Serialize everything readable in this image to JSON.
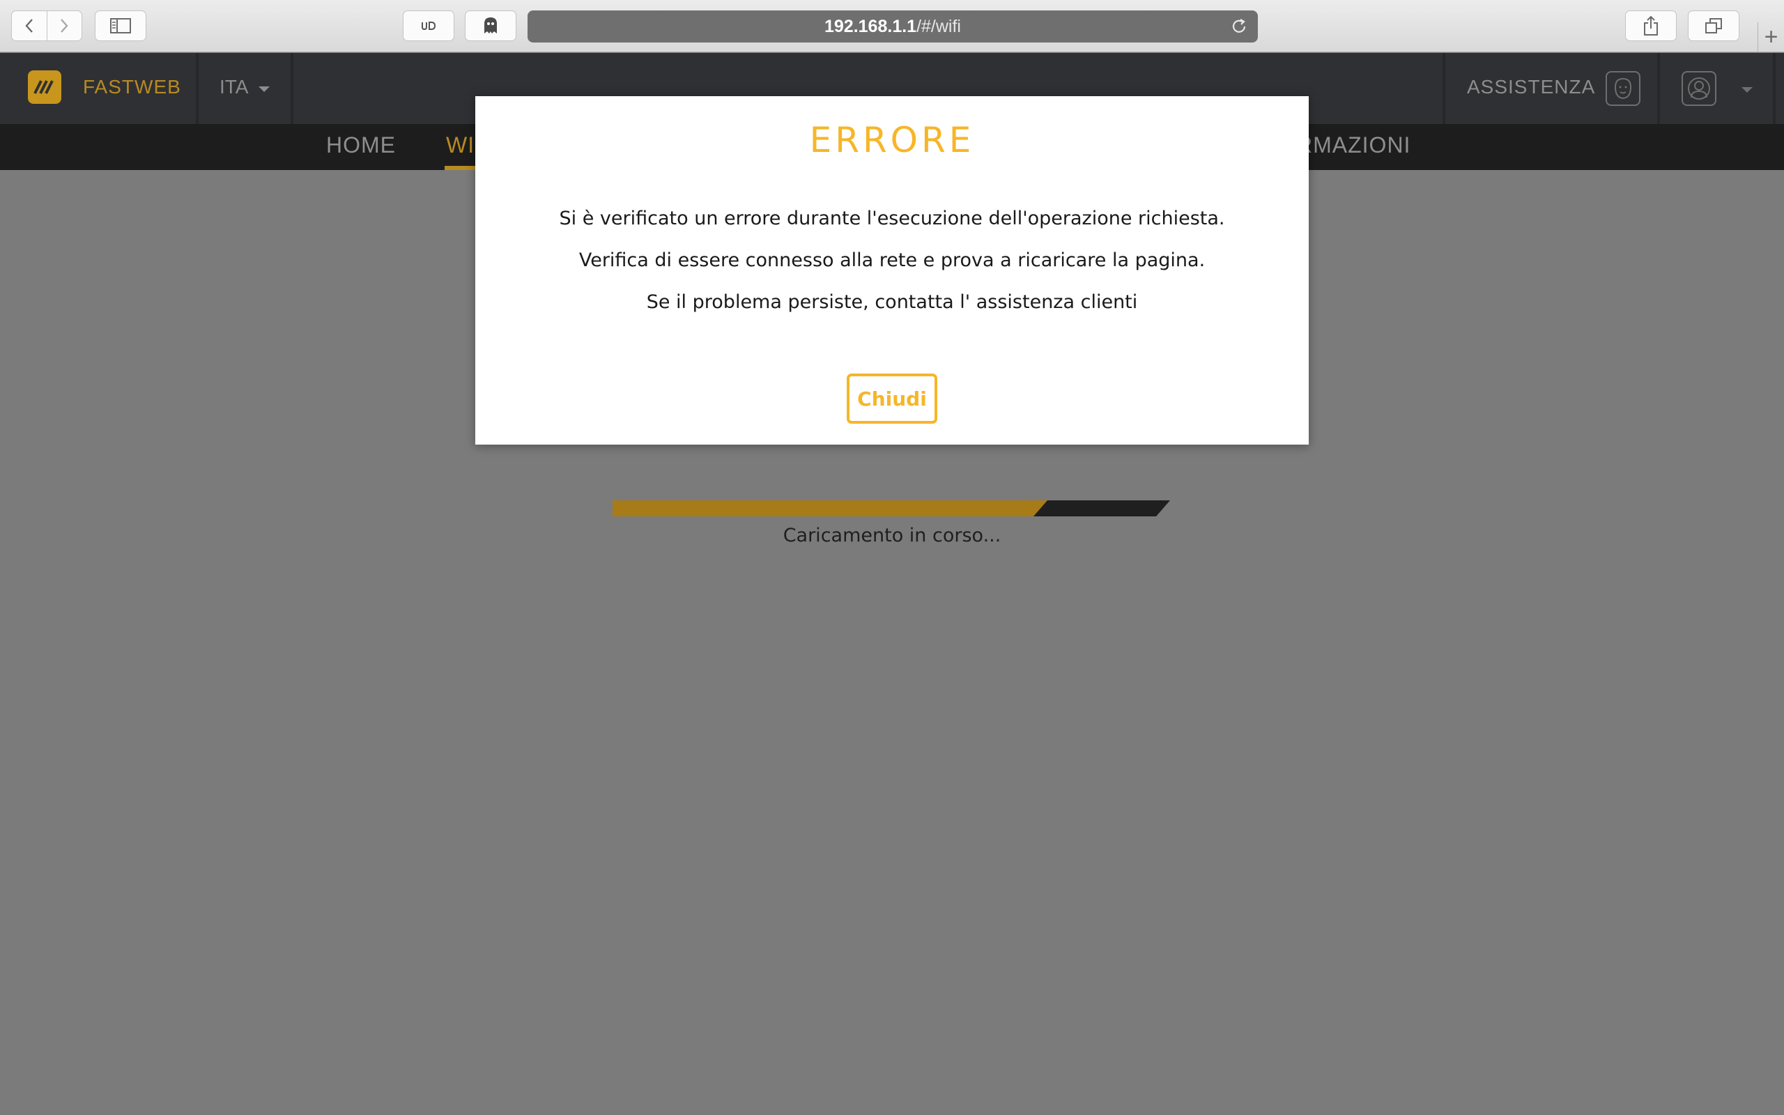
{
  "browser": {
    "url_host": "192.168.1.1",
    "url_path": "/#/wifi",
    "new_tab": "+"
  },
  "header": {
    "brand": "FASTWEB",
    "language": "ITA",
    "assist_label": "ASSISTENZA"
  },
  "menu": {
    "items": [
      {
        "label": "HOME"
      },
      {
        "label": "WI"
      },
      {
        "label": "RMAZIONI"
      }
    ]
  },
  "loading": {
    "text": "Caricamento in corso...",
    "progress_fraction": 0.78
  },
  "modal": {
    "title": "ERRORE",
    "lines": [
      "Si è verificato un errore durante l'esecuzione dell'operazione richiesta.",
      "Verifica di essere connesso alla rete e prova a ricaricare la pagina.",
      "Se il problema persiste, contatta l' assistenza clienti"
    ],
    "close_label": "Chiudi"
  },
  "colors": {
    "accent": "#f6b628",
    "brand_dim": "#b88a22",
    "progress_fill": "#a77b17",
    "progress_track": "#1f1f1f",
    "backdrop": "#7b7b7b"
  }
}
